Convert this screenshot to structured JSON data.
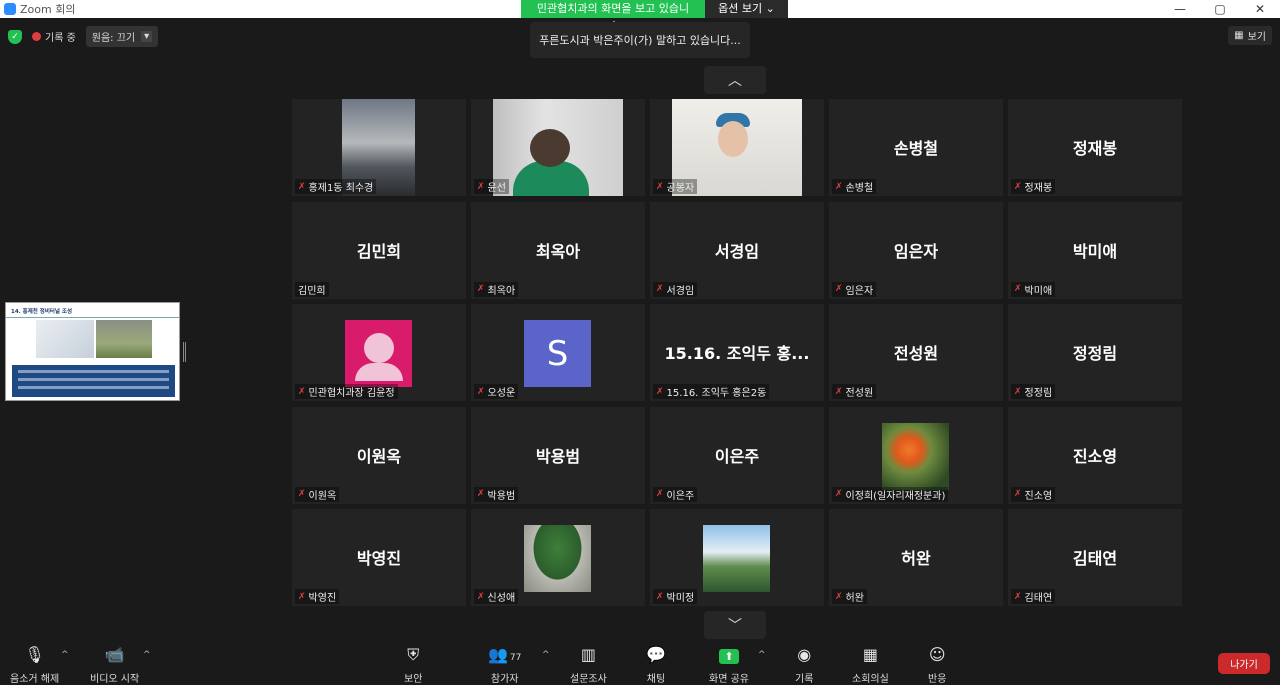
{
  "window": {
    "title": "Zoom 회의",
    "controls": [
      "—",
      "▢",
      "✕"
    ]
  },
  "share_banner": {
    "message": "민관협치과의 화면을 보고 있습니다.",
    "options_label": "옵션 보기 ⌄"
  },
  "topbar": {
    "recording_label": "기록 중",
    "audio_label": "원음: 끄기",
    "audio_caret": "▾",
    "view_label": "보기"
  },
  "speaking_notice": "푸른도시과 박은주이(가) 말하고 있습니다...",
  "nav": {
    "up": "︿",
    "down": "﹀"
  },
  "tiles": [
    {
      "big": "",
      "label": "홍제1동 최수경"
    },
    {
      "big": "",
      "label": "윤선"
    },
    {
      "big": "",
      "label": "공봉자"
    },
    {
      "big": "손병철",
      "label": "손병철"
    },
    {
      "big": "정재봉",
      "label": "정재봉"
    },
    {
      "big": "김민희",
      "label": "김민희"
    },
    {
      "big": "최옥아",
      "label": "최옥아"
    },
    {
      "big": "서경임",
      "label": "서경임"
    },
    {
      "big": "임은자",
      "label": "임은자"
    },
    {
      "big": "박미애",
      "label": "박미애"
    },
    {
      "big": "",
      "label": "민관협치과장 김윤정"
    },
    {
      "big": "S",
      "label": "오성운"
    },
    {
      "big": "15.16. 조익두 홍...",
      "label": "15.16. 조익두 홍은2동"
    },
    {
      "big": "전성원",
      "label": "전성원"
    },
    {
      "big": "정정림",
      "label": "정정림"
    },
    {
      "big": "이원옥",
      "label": "이원옥"
    },
    {
      "big": "박용범",
      "label": "박용범"
    },
    {
      "big": "이은주",
      "label": "이은주"
    },
    {
      "big": "",
      "label": "이정희(일자리재정분과)"
    },
    {
      "big": "진소영",
      "label": "진소영"
    },
    {
      "big": "박영진",
      "label": "박영진"
    },
    {
      "big": "",
      "label": "신성애"
    },
    {
      "big": "",
      "label": "박미정"
    },
    {
      "big": "허완",
      "label": "허완"
    },
    {
      "big": "김태연",
      "label": "김태연"
    }
  ],
  "share_thumbnail": {
    "title": "14. 홍제천 정비터널 조성"
  },
  "toolbar": {
    "unmute": "음소거 해제",
    "start_video": "비디오 시작",
    "security": "보안",
    "participants": "참가자",
    "participants_count": "77",
    "polls": "설문조사",
    "chat": "채팅",
    "share_screen": "화면 공유",
    "record": "기록",
    "breakout": "소회의실",
    "reactions": "반응",
    "leave": "나가기",
    "caret": "^"
  }
}
